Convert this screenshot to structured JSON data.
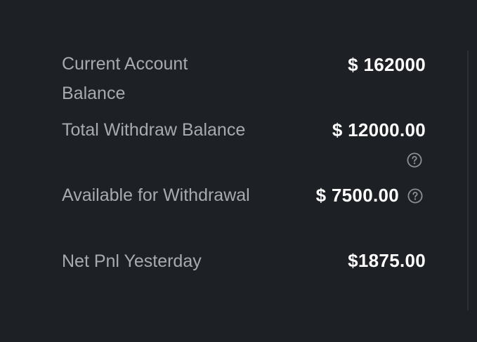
{
  "balances": {
    "current_account_balance": {
      "label_line1": "Current Account",
      "label_line2": "Balance",
      "value": "$ 162000"
    },
    "total_withdraw_balance": {
      "label": "Total Withdraw Balance",
      "value": "$ 12000.00",
      "icon": "help-circle-icon"
    },
    "available_for_withdrawal": {
      "label": "Available for Withdrawal",
      "value": "$ 7500.00",
      "icon": "help-circle-icon"
    },
    "net_pnl_yesterday": {
      "label": "Net Pnl Yesterday",
      "value": "$1875.00"
    }
  },
  "colors": {
    "background": "#1d2024",
    "label": "#a7abb1",
    "value": "#ffffff",
    "icon": "#8d9197"
  }
}
